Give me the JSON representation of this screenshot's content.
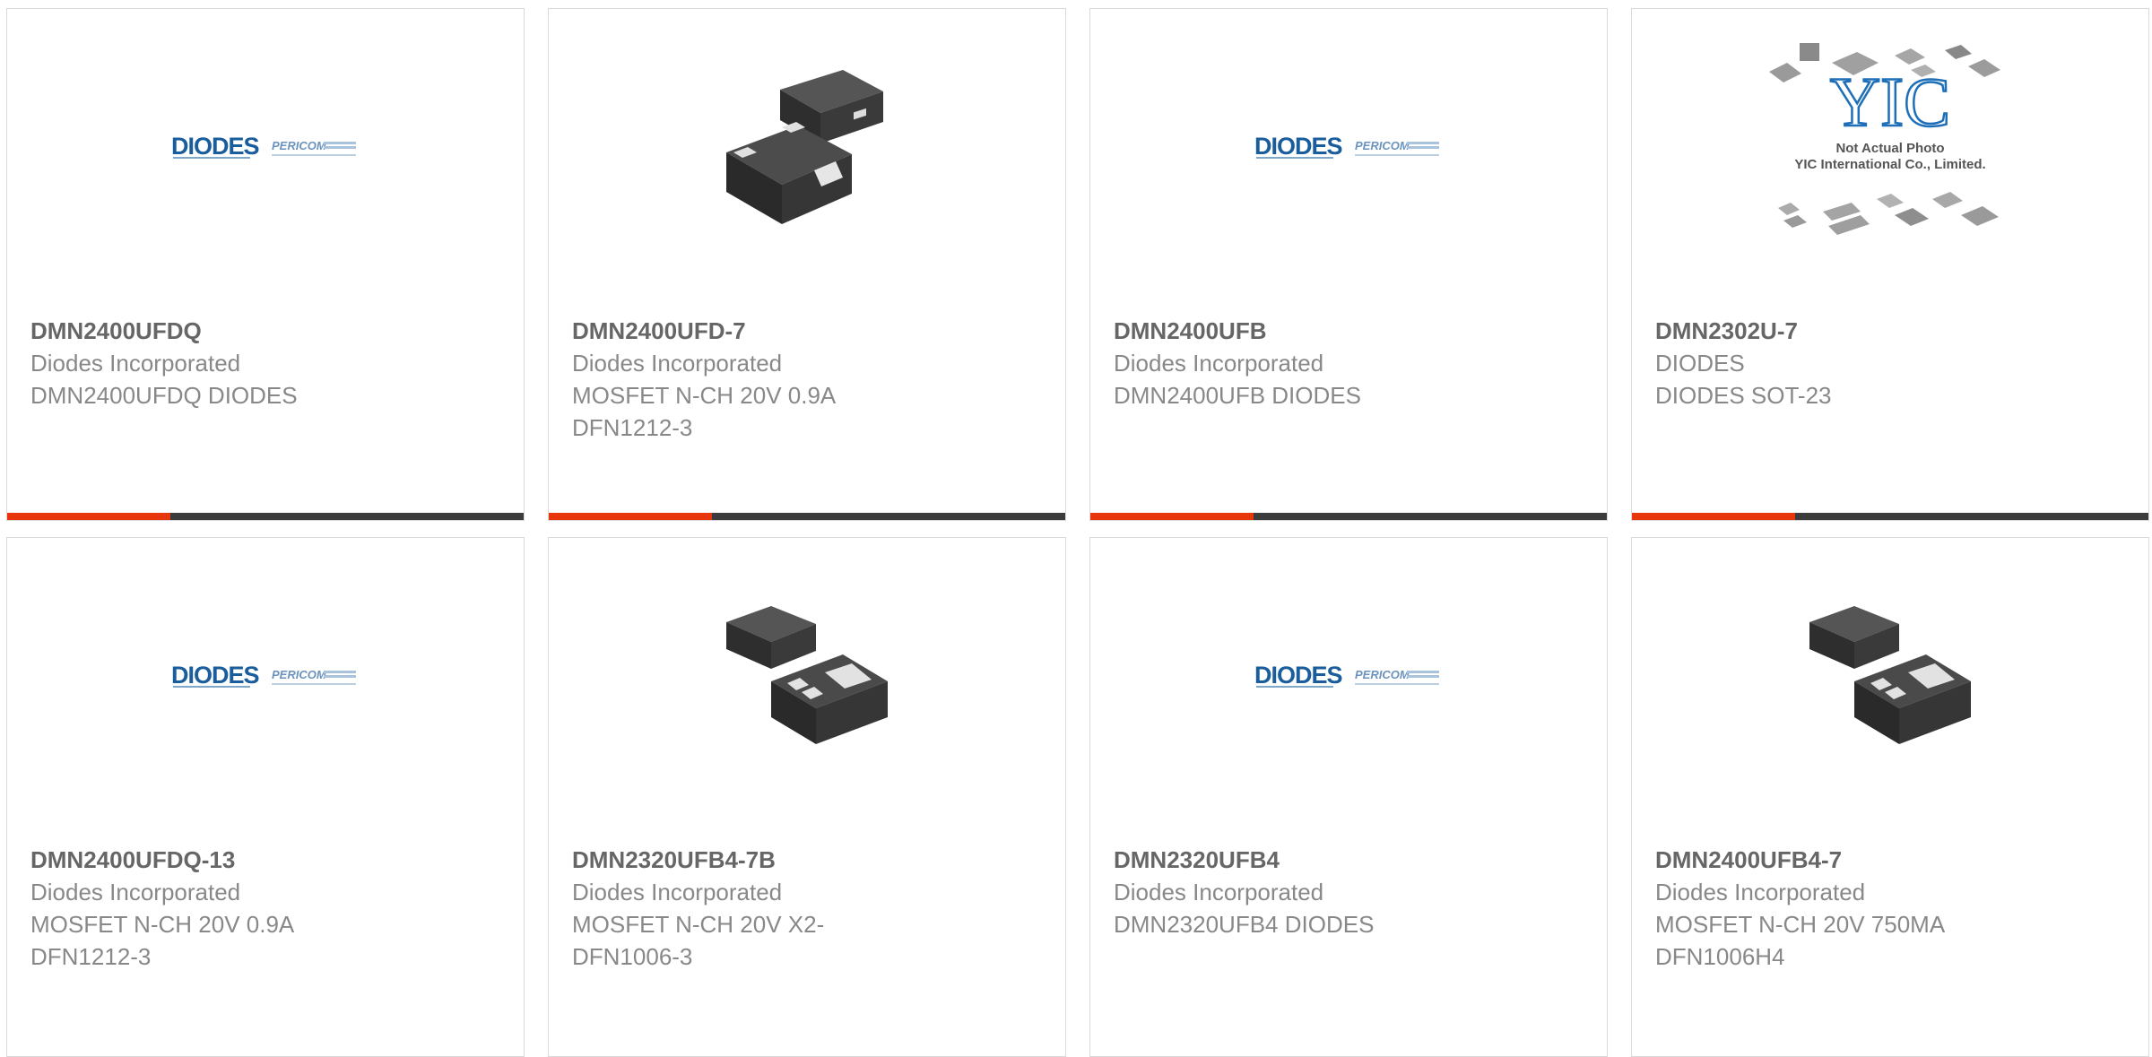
{
  "colors": {
    "accent": "#e8360c",
    "bar": "#3c3c3c",
    "title": "#666666",
    "text": "#888888"
  },
  "products": [
    {
      "part_number": "DMN2400UFDQ",
      "manufacturer": "Diodes Incorporated",
      "description": "DMN2400UFDQ DIODES",
      "image": "diodes-pericom-logo"
    },
    {
      "part_number": "DMN2400UFD-7",
      "manufacturer": "Diodes Incorporated",
      "description": "MOSFET N-CH 20V 0.9A DFN1212-3",
      "image": "chip-package-photo-a"
    },
    {
      "part_number": "DMN2400UFB",
      "manufacturer": "Diodes Incorporated",
      "description": "DMN2400UFB DIODES",
      "image": "diodes-pericom-logo"
    },
    {
      "part_number": "DMN2302U-7",
      "manufacturer": "DIODES",
      "description": "DIODES SOT-23",
      "image": "yic-not-actual-photo",
      "image_text": {
        "logo": "YIC",
        "line1": "Not Actual Photo",
        "line2": "YIC International Co., Limited."
      }
    },
    {
      "part_number": "DMN2400UFDQ-13",
      "manufacturer": "Diodes Incorporated",
      "description": "MOSFET N-CH 20V 0.9A DFN1212-3",
      "image": "diodes-pericom-logo"
    },
    {
      "part_number": "DMN2320UFB4-7B",
      "manufacturer": "Diodes Incorporated",
      "description": "MOSFET N-CH 20V X2-DFN1006-3",
      "image": "chip-package-photo-b"
    },
    {
      "part_number": "DMN2320UFB4",
      "manufacturer": "Diodes Incorporated",
      "description": "DMN2320UFB4 DIODES",
      "image": "diodes-pericom-logo"
    },
    {
      "part_number": "DMN2400UFB4-7",
      "manufacturer": "Diodes Incorporated",
      "description": "MOSFET N-CH 20V 750MA DFN1006H4",
      "image": "chip-package-photo-b"
    }
  ]
}
